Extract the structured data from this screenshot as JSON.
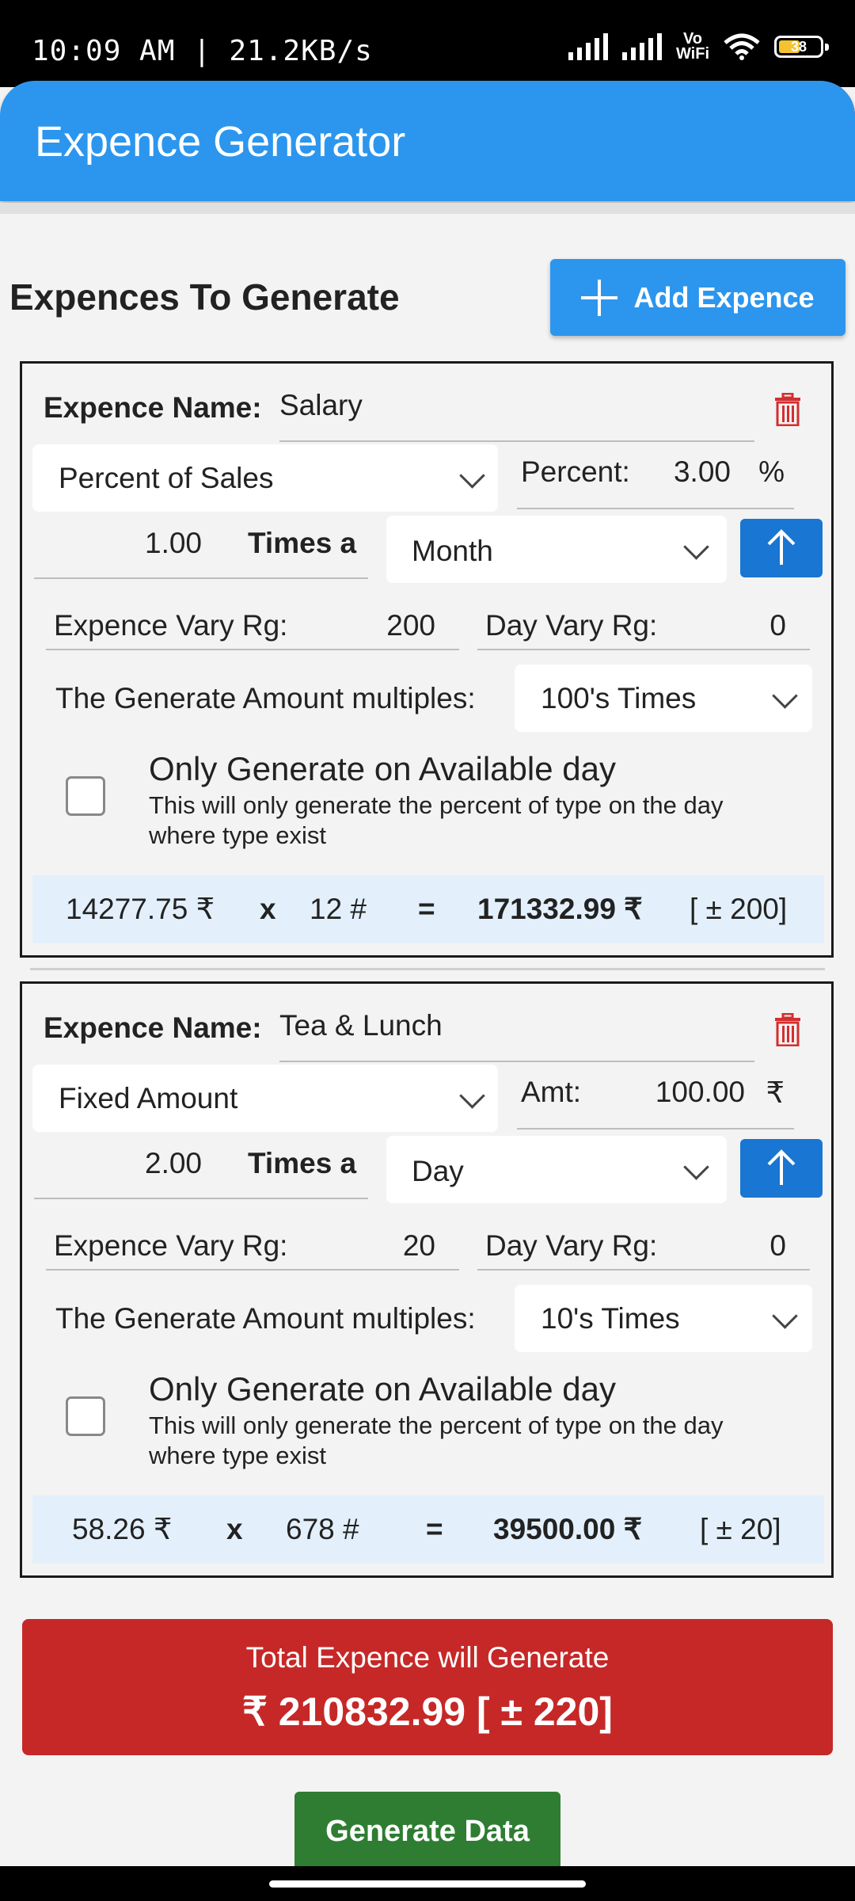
{
  "status_bar": {
    "time": "10:09 AM | 21.2KB/s",
    "vowifi_top": "Vo",
    "vowifi_bottom": "WiFi",
    "battery": "38",
    "battery_color": "#f5c331"
  },
  "app_bar": {
    "title": "Expence Generator",
    "color": "#2c96ee"
  },
  "section": {
    "title": "Expences To Generate",
    "add_button": "Add Expence"
  },
  "expenses": [
    {
      "name_label": "Expence Name:",
      "name_value": "Salary",
      "type": "Percent of Sales",
      "amount_label": "Percent:",
      "amount_value": "3.00",
      "amount_unit": "%",
      "times_value": "1.00",
      "times_label": "Times a",
      "period": "Month",
      "vary_label": "Expence Vary Rg:",
      "vary_value": "200",
      "day_vary_label": "Day Vary Rg:",
      "day_vary_value": "0",
      "multiples_label": "The Generate Amount multiples:",
      "multiples_value": "100's Times",
      "checkbox_title": "Only Generate on Available day",
      "checkbox_desc_1": "This will only generate the percent of type on the day",
      "checkbox_desc_2": "where type exist",
      "checkbox_checked": false,
      "summary": {
        "unit_amount": "14277.75 ₹",
        "x": "x",
        "count": "12 #",
        "eq": "=",
        "total": "171332.99 ₹",
        "range": "[ ± 200]"
      }
    },
    {
      "name_label": "Expence Name:",
      "name_value": "Tea & Lunch",
      "type": "Fixed Amount",
      "amount_label": "Amt:",
      "amount_value": "100.00",
      "amount_unit": "₹",
      "times_value": "2.00",
      "times_label": "Times a",
      "period": "Day",
      "vary_label": "Expence Vary Rg:",
      "vary_value": "20",
      "day_vary_label": "Day Vary Rg:",
      "day_vary_value": "0",
      "multiples_label": "The Generate Amount multiples:",
      "multiples_value": "10's Times",
      "checkbox_title": "Only Generate on Available day",
      "checkbox_desc_1": "This will only generate the percent of type on the day",
      "checkbox_desc_2": "where type exist",
      "checkbox_checked": false,
      "summary": {
        "unit_amount": "58.26 ₹",
        "x": "x",
        "count": "678 #",
        "eq": "=",
        "total": "39500.00 ₹",
        "range": "[ ± 20]"
      }
    }
  ],
  "total": {
    "label": "Total Expence will Generate",
    "value": "₹ 210832.99 [ ± 220]",
    "color": "#c62828"
  },
  "generate_button": {
    "label": "Generate Data",
    "color": "#2e7d32"
  },
  "icons": {
    "add": "plus-icon",
    "delete": "trash-icon",
    "sort": "arrow-up-icon",
    "dropdown": "chevron-down-icon"
  }
}
